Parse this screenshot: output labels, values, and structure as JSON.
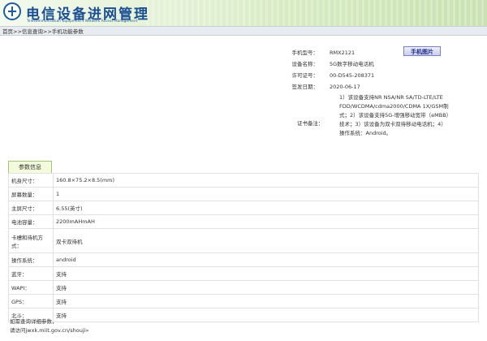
{
  "header": {
    "title": "电信设备进网管理",
    "subtitle": "Telecommunication Equipment's Network Access Management",
    "logo_icon": "telecom-logo-icon"
  },
  "breadcrumb": "首页>>信息查询>>手机功能参数",
  "info": {
    "rows": [
      {
        "label": "手机型号：",
        "value": "RMX2121"
      },
      {
        "label": "设备名称：",
        "value": "5G数字移动电话机"
      },
      {
        "label": "许可证号：",
        "value": "00-D545-208371"
      },
      {
        "label": "签发日期：",
        "value": "2020-06-17"
      }
    ],
    "photo_button": "手机图片",
    "remark_label": "证书备注：",
    "remark_text": "1）该设备支持NR NSA/NR SA/TD-LTE/LTE FDD/WCDMA/cdma2000/CDMA 1X/GSM制式；2）该设备支持5G-增强移动宽带（eMBB）技术；3）该设备为双卡双待移动电话机；4）操作系统：Android。"
  },
  "params": {
    "tab_label": "参数信息",
    "rows": [
      {
        "key": "机身尺寸：",
        "value": "160.8×75.2×8.5(mm)"
      },
      {
        "key": "屏幕数量：",
        "value": "1"
      },
      {
        "key": "主屏尺寸：",
        "value": "6.55(英寸)"
      },
      {
        "key": "电池容量：",
        "value": "2200mAHmAH"
      },
      {
        "key": "卡槽和待机方式：",
        "value": "双卡双待机"
      },
      {
        "key": "操作系统：",
        "value": "android"
      },
      {
        "key": "蓝牙：",
        "value": "支持"
      },
      {
        "key": "WAPI：",
        "value": "支持"
      },
      {
        "key": "GPS：",
        "value": "支持"
      },
      {
        "key": "北斗：",
        "value": "支持"
      }
    ]
  },
  "footer": {
    "line1": "如需查询详细参数，",
    "line2": "请访问jwxk.miit.gov.cn/shouji»"
  },
  "colors": {
    "title_blue": "#1a4f94",
    "button_text": "#1f2b8c",
    "tab_bg": "#f3fbdc"
  }
}
